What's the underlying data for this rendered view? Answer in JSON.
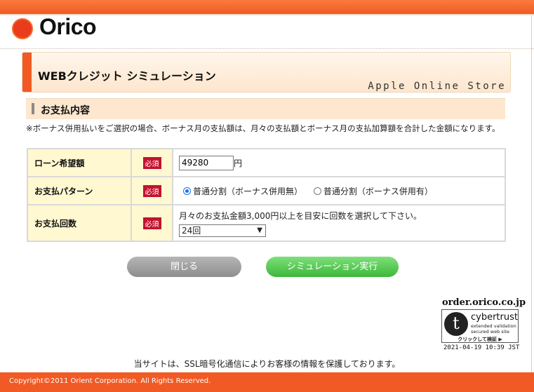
{
  "header": {
    "logo_text": "Orico",
    "brand_color": "#f15a24"
  },
  "title": {
    "main": "WEBクレジット シミュレーション",
    "store": "Apple Online Store"
  },
  "section": {
    "title": "お支払内容",
    "notice": "※ボーナス併用払いをご選択の場合、ボーナス月の支払額は、月々の支払額とボーナス月の支払加算額を合計した金額になります。"
  },
  "form": {
    "required_label": "必須",
    "loan": {
      "label": "ローン希望額",
      "value": "49280",
      "unit": "円"
    },
    "pattern": {
      "label": "お支払パターン",
      "option1": "普通分割（ボーナス併用無）",
      "option2": "普通分割（ボーナス併用有）",
      "selected": "option1"
    },
    "count": {
      "label": "お支払回数",
      "hint": "月々のお支払金額3,000円以上を目安に回数を選択して下さい。",
      "selected": "24回"
    }
  },
  "buttons": {
    "close": "閉じる",
    "simulate": "シミュレーション実行"
  },
  "seal": {
    "domain": "order.orico.co.jp",
    "brand": "cybertrust",
    "line1": "extended validation",
    "line2": "secured web site",
    "click": "クリックして検証 ▶",
    "timestamp": "2021-04-19 10:39 JST"
  },
  "footer": {
    "ssl_note": "当サイトは、SSL暗号化通信によりお客様の情報を保護しております。",
    "copyright": "Copyright©2011 Orient Corporation. All Rights Reserved."
  }
}
